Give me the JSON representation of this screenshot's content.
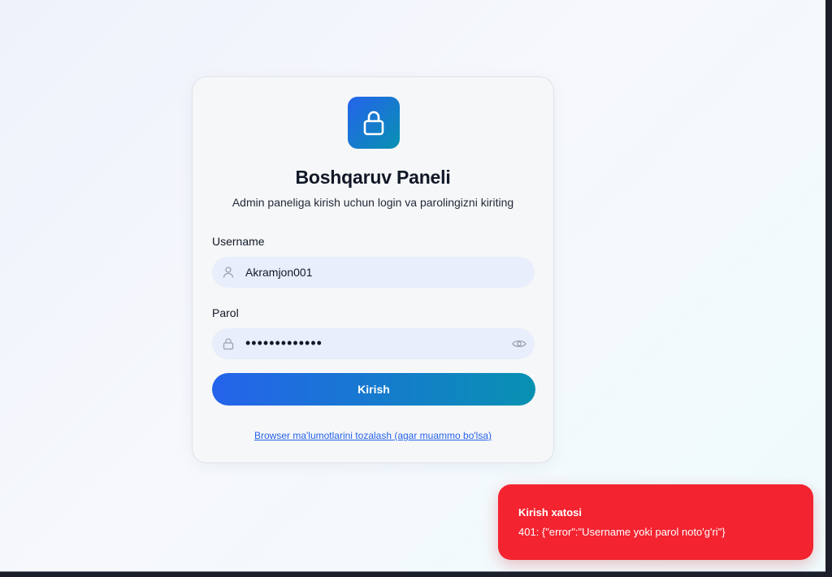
{
  "card": {
    "title": "Boshqaruv Paneli",
    "subtitle": "Admin paneliga kirish uchun login va parolingizni kiriting",
    "logo_icon": "lock-icon"
  },
  "form": {
    "username": {
      "label": "Username",
      "value": "Akramjon001",
      "icon": "user-icon"
    },
    "password": {
      "label": "Parol",
      "masked_value": "•••••••••••••",
      "icon": "lock-icon",
      "toggle_icon": "eye-icon"
    },
    "submit_label": "Kirish",
    "clear_link": "Browser ma'lumotlarini tozalash (agar muammo bo'lsa)"
  },
  "toast": {
    "title": "Kirish xatosi",
    "message": "401: {\"error\":\"Username yoki parol noto'g'ri\"}",
    "color": "#f42330"
  },
  "colors": {
    "accent_start": "#2563eb",
    "accent_end": "#0891b2",
    "field_bg": "#e8eefb"
  }
}
